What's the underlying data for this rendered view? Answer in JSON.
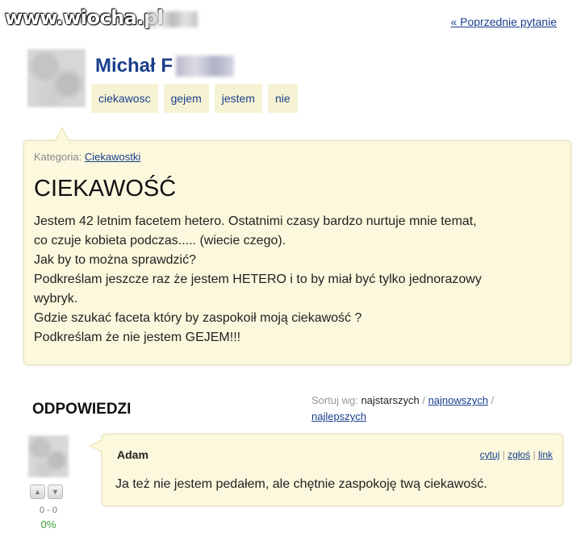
{
  "watermark": "www.wiocha.pl",
  "nav": {
    "prev_question": "« Poprzednie pytanie"
  },
  "author": {
    "name": "Michał F",
    "tags": [
      "ciekawosc",
      "gejem",
      "jestem",
      "nie"
    ]
  },
  "question": {
    "category_label": "Kategoria:",
    "category": "Ciekawostki",
    "title": "CIEKAWOŚĆ",
    "body_lines": [
      "Jestem 42 letnim facetem hetero. Ostatnimi czasy bardzo nurtuje mnie temat,",
      "co czuje kobieta podczas..... (wiecie czego).",
      "Jak by to można sprawdzić?",
      "Podkreślam jeszcze raz że jestem HETERO i to by miał być tylko jednorazowy",
      "wybryk.",
      "Gdzie szukać faceta który by zaspokoił moją ciekawość ?",
      "Podkreślam że nie jestem GEJEM!!!"
    ]
  },
  "answers_section": {
    "heading": "ODPOWIEDZI",
    "sort_label": "Sortuj wg:",
    "sort_current": "najstarszych",
    "sep1": "/",
    "sort_newest": "najnowszych",
    "sep2": "/",
    "sort_best": "najlepszych"
  },
  "answer": {
    "author": "Adam",
    "action_quote": "cytuj",
    "action_sep1": "|",
    "action_report": "zgłoś",
    "action_sep2": "|",
    "action_link": "link",
    "text": "Ja też nie jestem pedałem, ale chętnie zaspokoję twą ciekawość.",
    "votes": "0 - 0",
    "percent": "0%"
  },
  "colors": {
    "link": "#1a3e8c",
    "box_bg": "#fbf8dd",
    "tag_bg": "#f6f3d4",
    "percent": "#3a9a3a"
  }
}
